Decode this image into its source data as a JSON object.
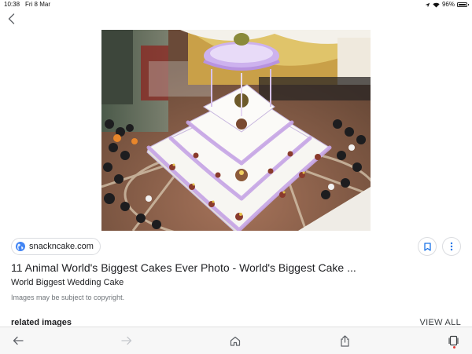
{
  "status": {
    "time": "10:38",
    "date": "Fri 8 Mar",
    "battery": "96%"
  },
  "nav": {
    "back_icon": "chevron-left-icon"
  },
  "source": {
    "site": "snackncake.com",
    "icon": "globe-icon"
  },
  "result": {
    "title": "11 Animal World's Biggest Cakes Ever Photo - World's Biggest Cake ...",
    "subtitle": "World Biggest Wedding Cake",
    "copyright": "Images may be subject to copyright."
  },
  "actions": {
    "save_icon": "bookmark-icon",
    "more_icon": "more-vert-icon"
  },
  "related": {
    "heading": "related images",
    "view_all": "VIEW ALL"
  },
  "toolbar": {
    "items": [
      "back-arrow-icon",
      "forward-arrow-icon",
      "home-icon",
      "share-icon",
      "tabs-icon"
    ]
  },
  "colors": {
    "accent": "#1a73e8",
    "tab_badge": "#e53935"
  }
}
